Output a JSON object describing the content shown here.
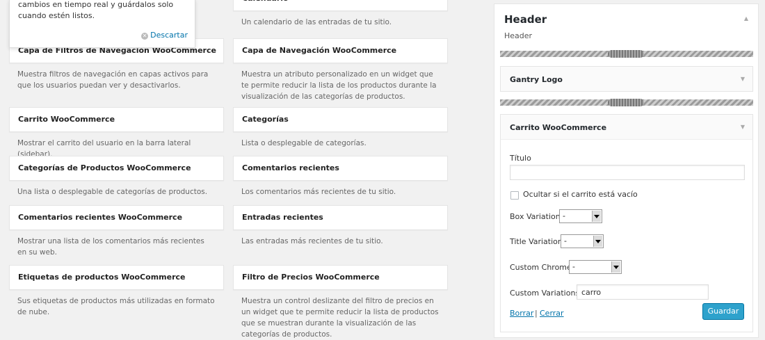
{
  "pointer": {
    "text": "cambios en tiempo real y guárdalos solo cuando estén listos.",
    "dismiss_label": "Descartar"
  },
  "widgets": [
    {
      "title": "",
      "desc": ""
    },
    {
      "title": "Calendario",
      "desc": "Un calendario de las entradas de tu sitio."
    },
    {
      "title": "Capa de Filtros de Navegación WooCommerce",
      "desc": "Muestra filtros de navegación en capas activos para que los usuarios puedan ver y desactivarlos."
    },
    {
      "title": "Capa de Navegación WooCommerce",
      "desc": "Muestra un atributo personalizado en un widget que te permite reducir la lista de los productos durante la visualización de las categorías de productos."
    },
    {
      "title": "Carrito WooCommerce",
      "desc": "Mostrar el carrito del usuario en la barra lateral (sidebar)."
    },
    {
      "title": "Categorías",
      "desc": "Lista o desplegable de categorías."
    },
    {
      "title": "Categorías de Productos WooCommerce",
      "desc": "Una lista o desplegable de categorías de productos."
    },
    {
      "title": "Comentarios recientes",
      "desc": "Los comentarios más recientes de tu sitio."
    },
    {
      "title": "Comentarios recientes WooCommerce",
      "desc": "Mostrar una lista de los comentarios más recientes en su web."
    },
    {
      "title": "Entradas recientes",
      "desc": "Las entradas más recientes de tu sitio."
    },
    {
      "title": "Etiquetas de productos WooCommerce",
      "desc": "Sus etiquetas de productos más utilizadas en formato de nube."
    },
    {
      "title": "Filtro de Precios WooCommerce",
      "desc": "Muestra un control deslizante del filtro de precios en un widget que te permite reducir la lista de productos que se muestran durante la visualización de las categorías de productos."
    }
  ],
  "sidebar": {
    "title": "Header",
    "description": "Header",
    "widgets": [
      {
        "title": "Gantry Logo"
      },
      {
        "title": "Carrito WooCommerce"
      }
    ],
    "form": {
      "title_label": "Título",
      "title_value": "",
      "hide_empty_label": "Ocultar si el carrito está vacío",
      "hide_empty_checked": false,
      "box_variation_label": "Box Variation",
      "box_variation_value": "-",
      "title_variation_label": "Title Variation",
      "title_variation_value": "-",
      "custom_chrome_label": "Custom Chrome",
      "custom_chrome_value": "-",
      "custom_variations_label": "Custom Variations",
      "custom_variations_value": "carro",
      "delete_label": "Borrar",
      "separator": "|",
      "close_label": "Cerrar",
      "save_label": "Guardar"
    }
  },
  "colors": {
    "background": "#f1f1f1",
    "link": "#0073aa",
    "primary_button": "#2ea2cc"
  }
}
